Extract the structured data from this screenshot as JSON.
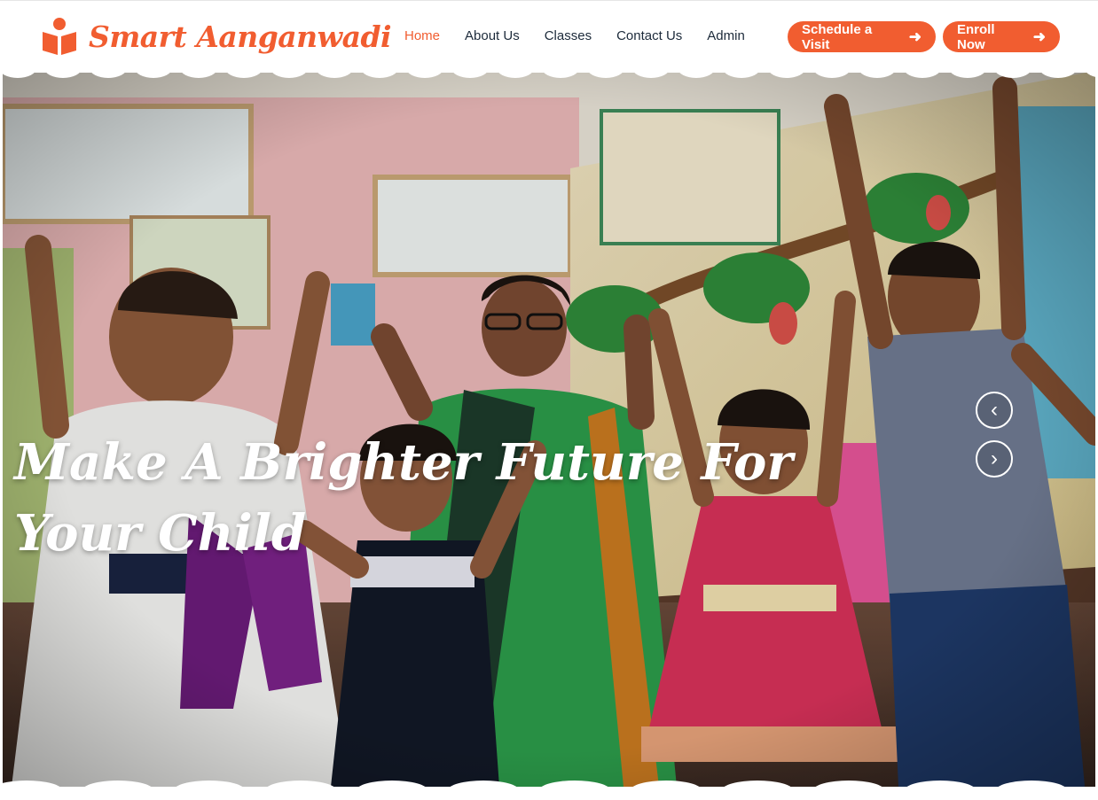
{
  "brand": {
    "name": "Smart Aanganwadi",
    "accent": "#f15d30"
  },
  "nav": {
    "items": [
      {
        "label": "Home",
        "active": true
      },
      {
        "label": "About Us",
        "active": false
      },
      {
        "label": "Classes",
        "active": false
      },
      {
        "label": "Contact Us",
        "active": false
      },
      {
        "label": "Admin",
        "active": false
      }
    ]
  },
  "cta": {
    "schedule_label": "Schedule a Visit",
    "enroll_label": "Enroll Now",
    "arrow_icon": "arrow-right-icon"
  },
  "hero": {
    "title_line1": "Make A Brighter Future For",
    "title_line2": "Your Child",
    "prev_icon": "chevron-left-icon",
    "next_icon": "chevron-right-icon"
  }
}
